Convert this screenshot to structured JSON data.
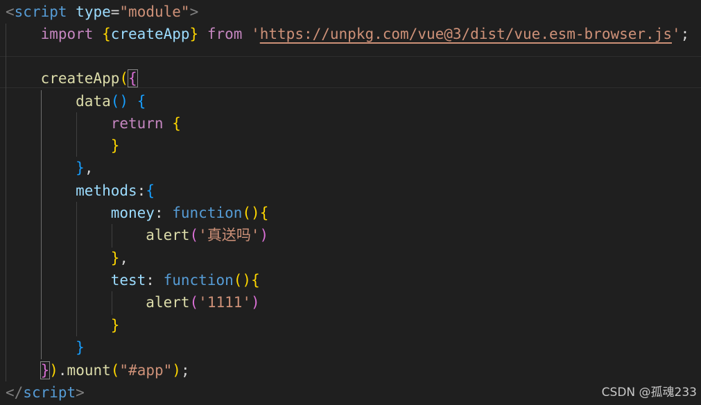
{
  "colors": {
    "background": "#1f1f1f",
    "punctuation": "#808080",
    "tag": "#569cd6",
    "attribute": "#9cdcfe",
    "string": "#ce9178",
    "keyword": "#c586c0",
    "function": "#dcdcaa",
    "property": "#9cdcfe",
    "plain": "#d4d4d4",
    "bracket_1": "#ffd700",
    "bracket_2": "#da70d6",
    "bracket_3": "#179fff"
  },
  "code_lines": [
    [
      [
        "<",
        "punctuation"
      ],
      [
        "script",
        "tag"
      ],
      [
        " ",
        "plain"
      ],
      [
        "type",
        "attribute"
      ],
      [
        "=",
        "plain"
      ],
      [
        "\"module\"",
        "string"
      ],
      [
        ">",
        "punctuation"
      ]
    ],
    [
      [
        "    ",
        "plain"
      ],
      [
        "import",
        "keyword"
      ],
      [
        " ",
        "plain"
      ],
      [
        "{",
        "bracket_1"
      ],
      [
        "createApp",
        "property"
      ],
      [
        "}",
        "bracket_1"
      ],
      [
        " ",
        "plain"
      ],
      [
        "from",
        "keyword"
      ],
      [
        " ",
        "plain"
      ],
      [
        "'",
        "string"
      ],
      [
        "https://unpkg.com/vue@3/dist/vue.esm-browser.js",
        "url"
      ],
      [
        "'",
        "string"
      ],
      [
        ";",
        "plain"
      ]
    ],
    [],
    [
      [
        "    ",
        "plain"
      ],
      [
        "createApp",
        "function"
      ],
      [
        "(",
        "bracket_1"
      ],
      [
        "{",
        "bracket_2"
      ]
    ],
    [
      [
        "        ",
        "plain"
      ],
      [
        "data",
        "function"
      ],
      [
        "()",
        "bracket_3"
      ],
      [
        " ",
        "plain"
      ],
      [
        "{",
        "bracket_3"
      ]
    ],
    [
      [
        "            ",
        "plain"
      ],
      [
        "return",
        "keyword"
      ],
      [
        " ",
        "plain"
      ],
      [
        "{",
        "bracket_1"
      ]
    ],
    [
      [
        "            ",
        "plain"
      ],
      [
        "}",
        "bracket_1"
      ]
    ],
    [
      [
        "        ",
        "plain"
      ],
      [
        "}",
        "bracket_3"
      ],
      [
        ",",
        "plain"
      ]
    ],
    [
      [
        "        ",
        "plain"
      ],
      [
        "methods",
        "property"
      ],
      [
        ":",
        "plain"
      ],
      [
        "{",
        "bracket_3"
      ]
    ],
    [
      [
        "            ",
        "plain"
      ],
      [
        "money",
        "property"
      ],
      [
        ":",
        "plain"
      ],
      [
        " ",
        "plain"
      ],
      [
        "function",
        "tag"
      ],
      [
        "()",
        "bracket_1"
      ],
      [
        "{",
        "bracket_1"
      ]
    ],
    [
      [
        "                ",
        "plain"
      ],
      [
        "alert",
        "function"
      ],
      [
        "(",
        "bracket_2"
      ],
      [
        "'真送吗'",
        "string"
      ],
      [
        ")",
        "bracket_2"
      ]
    ],
    [
      [
        "            ",
        "plain"
      ],
      [
        "}",
        "bracket_1"
      ],
      [
        ",",
        "plain"
      ]
    ],
    [
      [
        "            ",
        "plain"
      ],
      [
        "test",
        "property"
      ],
      [
        ":",
        "plain"
      ],
      [
        " ",
        "plain"
      ],
      [
        "function",
        "tag"
      ],
      [
        "()",
        "bracket_1"
      ],
      [
        "{",
        "bracket_1"
      ]
    ],
    [
      [
        "                ",
        "plain"
      ],
      [
        "alert",
        "function"
      ],
      [
        "(",
        "bracket_2"
      ],
      [
        "'1111'",
        "string"
      ],
      [
        ")",
        "bracket_2"
      ]
    ],
    [
      [
        "            ",
        "plain"
      ],
      [
        "}",
        "bracket_1"
      ]
    ],
    [
      [
        "        ",
        "plain"
      ],
      [
        "}",
        "bracket_3"
      ]
    ],
    [
      [
        "    ",
        "plain"
      ],
      [
        "}",
        "bracket_2"
      ],
      [
        ")",
        "bracket_1"
      ],
      [
        ".",
        "plain"
      ],
      [
        "mount",
        "function"
      ],
      [
        "(",
        "bracket_1"
      ],
      [
        "\"#app\"",
        "string"
      ],
      [
        ")",
        "bracket_1"
      ],
      [
        ";",
        "plain"
      ]
    ],
    [
      [
        "</",
        "punctuation"
      ],
      [
        "script",
        "tag"
      ],
      [
        ">",
        "punctuation"
      ]
    ]
  ],
  "watermark": "CSDN @孤魂233"
}
